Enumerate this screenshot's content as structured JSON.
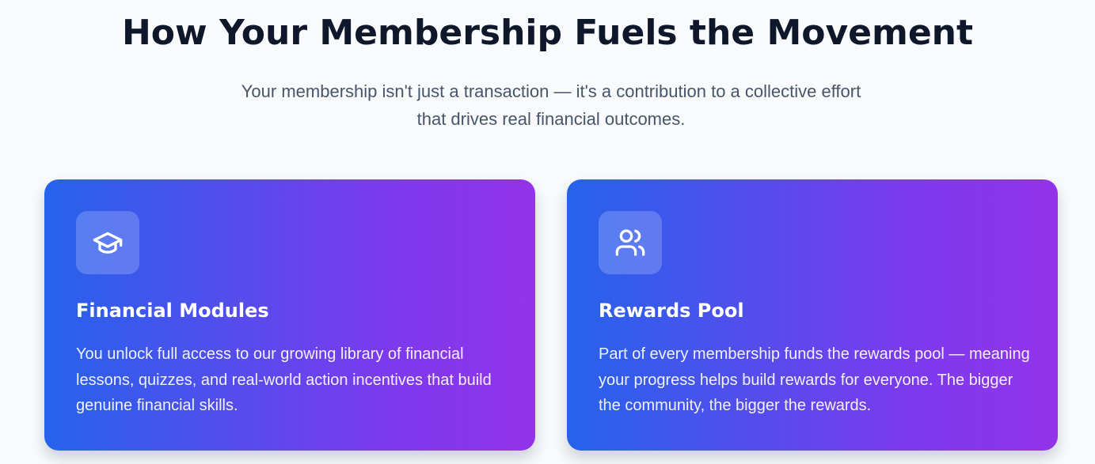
{
  "header": {
    "title": "How Your Membership Fuels the Movement",
    "subtitle": "Your membership isn't just a transaction — it's a contribution to a collective effort that drives real financial outcomes."
  },
  "cards": [
    {
      "icon": "graduation-cap-icon",
      "title": "Financial Modules",
      "text": "You unlock full access to our growing library of financial lessons, quizzes, and real-world action incentives that build genuine financial skills."
    },
    {
      "icon": "users-icon",
      "title": "Rewards Pool",
      "text": "Part of every membership funds the rewards pool — meaning your progress helps build rewards for everyone. The bigger the community, the bigger the rewards."
    }
  ],
  "colors": {
    "gradient_start": "#2563eb",
    "gradient_end": "#9333ea",
    "title": "#0f172a",
    "subtitle": "#475569",
    "background": "#f8fafc"
  }
}
